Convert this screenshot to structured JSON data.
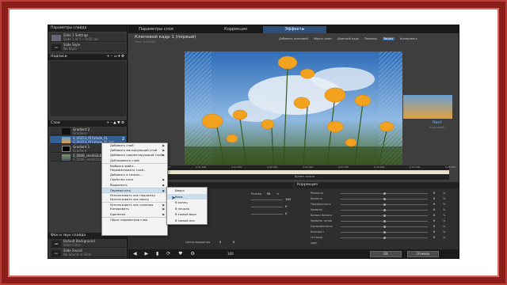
{
  "left_panel": {
    "header": "Параметры слайда",
    "slides": [
      {
        "title": "Slide 1 Settings",
        "sub": "Slide 1 of 5 • 0:05 sec"
      },
      {
        "title": "Slide Style",
        "sub": "No Style"
      }
    ],
    "captions_header": "Надписи",
    "layers_header": "Слои",
    "layers": [
      {
        "title": "Gradient 2",
        "sub": "Gradient"
      },
      {
        "title": "0_00253_f07afade_XL",
        "sub": "0_00253_f07afade_XL.jpg"
      },
      {
        "title": "Gradient 1",
        "sub": "Gradient"
      },
      {
        "title": "0_0848_ceeda3cb",
        "sub": "0_0848_ceeda3cb.jpg"
      }
    ],
    "bg_header": "Фон и звук слайда",
    "bg_items": [
      {
        "title": "Default Background",
        "sub": "Slide Color"
      },
      {
        "title": "Slide Sound",
        "sub": "No Sound in Slide"
      }
    ],
    "layer_badges": [
      "2",
      "1"
    ]
  },
  "tabs": [
    "Параметры слоя",
    "Коррекция",
    "Эффекты"
  ],
  "keyframe": {
    "title": "Ключевой кадр 1 (первый)",
    "sub": "Time: 0:00.000"
  },
  "toolbar": [
    "Добавить ключевой",
    "Убрать ключ",
    "Длинный кадр",
    "Переход",
    "Видео",
    "Копировать"
  ],
  "next_thumb": {
    "label": "Next",
    "sub": "Ключевой 2"
  },
  "timeline_ticks": [
    "0:01.000",
    "0:01.500",
    "0:02.000",
    "0:02.500",
    "0:03.000",
    "0:03.500",
    "0:04.000",
    "0:04.500",
    "0:05.000"
  ],
  "timeline_label": "Время: ключа",
  "props_left_header": "Параметры",
  "props_right_header": "Коррекция",
  "props_fields": [
    "Размер",
    "95",
    "%"
  ],
  "props_row_labels": [
    "Центр вращения",
    "Угол"
  ],
  "props_center_values": [
    "0",
    "0"
  ],
  "props_slider_values": [
    "100",
    "0",
    "0"
  ],
  "correction_labels": [
    "Резкость",
    "Яркость",
    "Прозрачность",
    "Уровень",
    "Баланс белого",
    "Уровень тонов",
    "Насыщенность",
    "Контраст",
    "Оттенок",
    "Цвет"
  ],
  "correction_values": [
    "0",
    "0",
    "0",
    "0",
    "0",
    "0",
    "0",
    "0",
    "0"
  ],
  "correction_units": [
    "%",
    "%",
    "%",
    "%",
    "%",
    "%",
    "%",
    "%",
    "%"
  ],
  "buttons": {
    "ok": "OK",
    "cancel": "Отмена"
  },
  "zoom": "100",
  "context_menu": [
    {
      "label": "Добавить слой",
      "sub": true
    },
    {
      "label": "Добавить маскирующий слой",
      "sub": true
    },
    {
      "label": "Добавить корректирующий слой",
      "sub": true
    },
    {
      "label": "Дублировать слой",
      "sub": false
    },
    {
      "label": "Выбрать файл...",
      "sub": false,
      "sep": true
    },
    {
      "label": "Переименовать слой...",
      "sub": false
    },
    {
      "label": "Добавить в список...",
      "sub": false
    },
    {
      "label": "Свойства слоя",
      "sub": true
    },
    {
      "label": "Выровнять",
      "sub": true
    },
    {
      "label": "Переместить",
      "sub": true,
      "sep": true
    },
    {
      "label": "Использовать как подложку",
      "sub": false,
      "sep": true
    },
    {
      "label": "Использовать как маску",
      "sub": false
    },
    {
      "label": "Использовать как границы",
      "sub": true,
      "sep": true
    },
    {
      "label": "Копировать",
      "sub": true
    },
    {
      "label": "Удаление",
      "sub": true
    },
    {
      "label": "Сброс параметров слоя",
      "sub": false,
      "sep": true
    }
  ],
  "submenu": [
    "Вверх",
    "Вниз",
    "В конец",
    "В начало",
    "В самый верх",
    "В самый низ"
  ]
}
